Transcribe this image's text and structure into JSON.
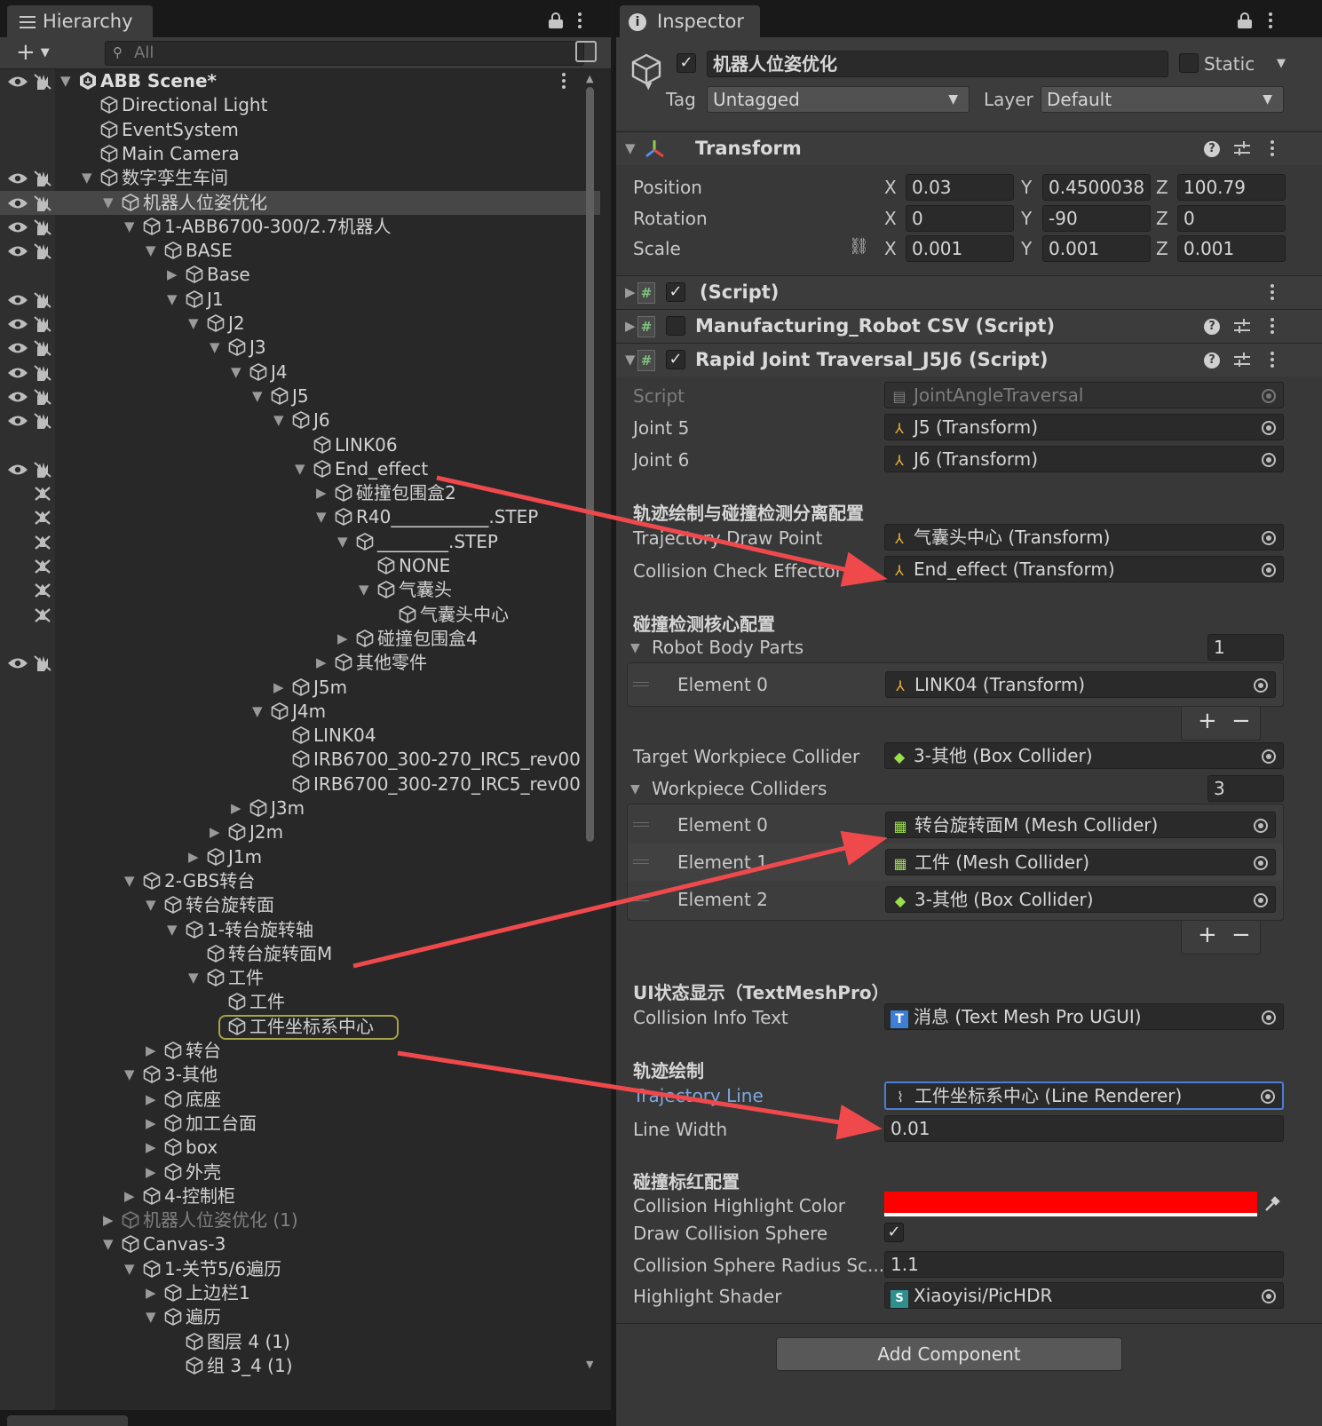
{
  "hierarchy": {
    "tab_label": "Hierarchy",
    "search_placeholder": "All",
    "rows": [
      {
        "label": "ABB Scene*",
        "depth": 0,
        "arrow": "down",
        "root": true,
        "vis": true,
        "kebab": true
      },
      {
        "label": "Directional Light",
        "depth": 1,
        "arrow": "none"
      },
      {
        "label": "EventSystem",
        "depth": 1,
        "arrow": "none"
      },
      {
        "label": "Main Camera",
        "depth": 1,
        "arrow": "none"
      },
      {
        "label": "数字孪生车间",
        "depth": 1,
        "arrow": "down",
        "vis": true
      },
      {
        "label": "机器人位姿优化",
        "depth": 2,
        "arrow": "down",
        "vis": true,
        "selected": true
      },
      {
        "label": "1-ABB6700-300/2.7机器人",
        "depth": 3,
        "arrow": "down",
        "vis": true
      },
      {
        "label": "BASE",
        "depth": 4,
        "arrow": "down",
        "vis": true
      },
      {
        "label": "Base",
        "depth": 5,
        "arrow": "right"
      },
      {
        "label": "J1",
        "depth": 5,
        "arrow": "down",
        "vis": true
      },
      {
        "label": "J2",
        "depth": 6,
        "arrow": "down",
        "vis": true
      },
      {
        "label": "J3",
        "depth": 7,
        "arrow": "down",
        "vis": true
      },
      {
        "label": "J4",
        "depth": 8,
        "arrow": "down",
        "vis": true
      },
      {
        "label": "J5",
        "depth": 9,
        "arrow": "down",
        "vis": true
      },
      {
        "label": "J6",
        "depth": 10,
        "arrow": "down",
        "vis": true
      },
      {
        "label": "LINK06",
        "depth": 11,
        "arrow": "none"
      },
      {
        "label": "End_effect",
        "depth": 11,
        "arrow": "down",
        "vis": true
      },
      {
        "label": "碰撞包围盒2",
        "depth": 12,
        "arrow": "right",
        "hand": true
      },
      {
        "label": "R40___________.STEP",
        "depth": 12,
        "arrow": "down",
        "hand": true
      },
      {
        "label": "________.STEP",
        "depth": 13,
        "arrow": "down",
        "hand": true
      },
      {
        "label": "NONE",
        "depth": 14,
        "arrow": "none",
        "hand": true
      },
      {
        "label": "气囊头",
        "depth": 14,
        "arrow": "down",
        "hand": true
      },
      {
        "label": "气囊头中心",
        "depth": 15,
        "arrow": "none",
        "hand": true
      },
      {
        "label": "碰撞包围盒4",
        "depth": 13,
        "arrow": "right"
      },
      {
        "label": "其他零件",
        "depth": 12,
        "arrow": "right",
        "vis": true
      },
      {
        "label": "J5m",
        "depth": 10,
        "arrow": "right"
      },
      {
        "label": "J4m",
        "depth": 9,
        "arrow": "down"
      },
      {
        "label": "LINK04",
        "depth": 10,
        "arrow": "none"
      },
      {
        "label": "IRB6700_300-270_IRC5_rev00",
        "depth": 10,
        "arrow": "none"
      },
      {
        "label": "IRB6700_300-270_IRC5_rev00",
        "depth": 10,
        "arrow": "none"
      },
      {
        "label": "J3m",
        "depth": 8,
        "arrow": "right"
      },
      {
        "label": "J2m",
        "depth": 7,
        "arrow": "right"
      },
      {
        "label": "J1m",
        "depth": 6,
        "arrow": "right"
      },
      {
        "label": "2-GBS转台",
        "depth": 3,
        "arrow": "down"
      },
      {
        "label": "转台旋转面",
        "depth": 4,
        "arrow": "down"
      },
      {
        "label": "1-转台旋转轴",
        "depth": 5,
        "arrow": "down"
      },
      {
        "label": "转台旋转面M",
        "depth": 6,
        "arrow": "none"
      },
      {
        "label": "工件",
        "depth": 6,
        "arrow": "down"
      },
      {
        "label": "工件",
        "depth": 7,
        "arrow": "none"
      },
      {
        "label": "工件坐标系中心",
        "depth": 7,
        "arrow": "none",
        "highlight": true
      },
      {
        "label": "转台",
        "depth": 4,
        "arrow": "right"
      },
      {
        "label": "3-其他",
        "depth": 3,
        "arrow": "down"
      },
      {
        "label": "底座",
        "depth": 4,
        "arrow": "right"
      },
      {
        "label": "加工台面",
        "depth": 4,
        "arrow": "right"
      },
      {
        "label": "box",
        "depth": 4,
        "arrow": "right"
      },
      {
        "label": "外壳",
        "depth": 4,
        "arrow": "right"
      },
      {
        "label": "4-控制柜",
        "depth": 3,
        "arrow": "right"
      },
      {
        "label": "机器人位姿优化 (1)",
        "depth": 2,
        "arrow": "right",
        "inactive": true
      },
      {
        "label": "Canvas-3",
        "depth": 2,
        "arrow": "down"
      },
      {
        "label": "1-关节5/6遍历",
        "depth": 3,
        "arrow": "down"
      },
      {
        "label": "上边栏1",
        "depth": 4,
        "arrow": "right"
      },
      {
        "label": "遍历",
        "depth": 4,
        "arrow": "down"
      },
      {
        "label": "图层 4 (1)",
        "depth": 5,
        "arrow": "none"
      },
      {
        "label": "组 3_4 (1)",
        "depth": 5,
        "arrow": "none"
      }
    ]
  },
  "inspector": {
    "tab_label": "Inspector",
    "object_name": "机器人位姿优化",
    "active": true,
    "static_label": "Static",
    "tag_label": "Tag",
    "tag_value": "Untagged",
    "layer_label": "Layer",
    "layer_value": "Default",
    "transform": {
      "title": "Transform",
      "position_label": "Position",
      "rotation_label": "Rotation",
      "scale_label": "Scale",
      "position": {
        "x": "0.03",
        "y": "0.4500038",
        "z": "100.79"
      },
      "rotation": {
        "x": "0",
        "y": "-90",
        "z": "0"
      },
      "scale": {
        "x": "0.001",
        "y": "0.001",
        "z": "0.001"
      },
      "axis_x": "X",
      "axis_y": "Y",
      "axis_z": "Z"
    },
    "comp_script": {
      "title": "(Script)"
    },
    "comp_manufacturing": {
      "title": "Manufacturing_Robot CSV (Script)"
    },
    "comp_rapid": {
      "title": "Rapid Joint Traversal_J5J6 (Script)"
    },
    "fields": {
      "script_label": "Script",
      "script_value": "JointAngleTraversal",
      "joint5_label": "Joint 5",
      "joint5_value": "J5 (Transform)",
      "joint6_label": "Joint 6",
      "joint6_value": "J6 (Transform)",
      "section_traj_collision": "轨迹绘制与碰撞检测分离配置",
      "traj_draw_point_label": "Trajectory Draw Point",
      "traj_draw_point_value": "气囊头中心 (Transform)",
      "collision_effector_label": "Collision Check Effector",
      "collision_effector_value": "End_effect (Transform)",
      "section_collision_core": "碰撞检测核心配置",
      "robot_body_parts_label": "Robot Body Parts",
      "robot_body_parts_count": "1",
      "rbp_element0_label": "Element 0",
      "rbp_element0_value": "LINK04 (Transform)",
      "target_collider_label": "Target Workpiece Collider",
      "target_collider_value": "3-其他 (Box Collider)",
      "workpiece_colliders_label": "Workpiece Colliders",
      "workpiece_colliders_count": "3",
      "wc_elements": [
        {
          "label": "Element 0",
          "value": "转台旋转面M (Mesh Collider)",
          "icon": "mesh"
        },
        {
          "label": "Element 1",
          "value": "工件 (Mesh Collider)",
          "icon": "mesh"
        },
        {
          "label": "Element 2",
          "value": "3-其他 (Box Collider)",
          "icon": "box"
        }
      ],
      "section_ui": "UI状态显示（TextMeshPro）",
      "collision_info_label": "Collision Info Text",
      "collision_info_value": "消息 (Text Mesh Pro UGUI)",
      "section_traj": "轨迹绘制",
      "traj_line_label": "Trajectory Line",
      "traj_line_value": "工件坐标系中心 (Line Renderer)",
      "line_width_label": "Line Width",
      "line_width_value": "0.01",
      "section_highlight": "碰撞标红配置",
      "highlight_color_label": "Collision Highlight Color",
      "highlight_color": "#ff0000",
      "draw_sphere_label": "Draw Collision Sphere",
      "draw_sphere_checked": true,
      "sphere_radius_label": "Collision Sphere Radius Sc...",
      "sphere_radius_value": "1.1",
      "shader_label": "Highlight Shader",
      "shader_value": "Xiaoyisi/PicHDR"
    },
    "add_component": "Add Component",
    "plus_glyph": "+",
    "minus_glyph": "−"
  },
  "colors": {
    "annotation_arrow": "#f0494c",
    "selection": "#474747",
    "highlight_outline": "#a6a24a",
    "link_blue": "#7da7e0"
  }
}
